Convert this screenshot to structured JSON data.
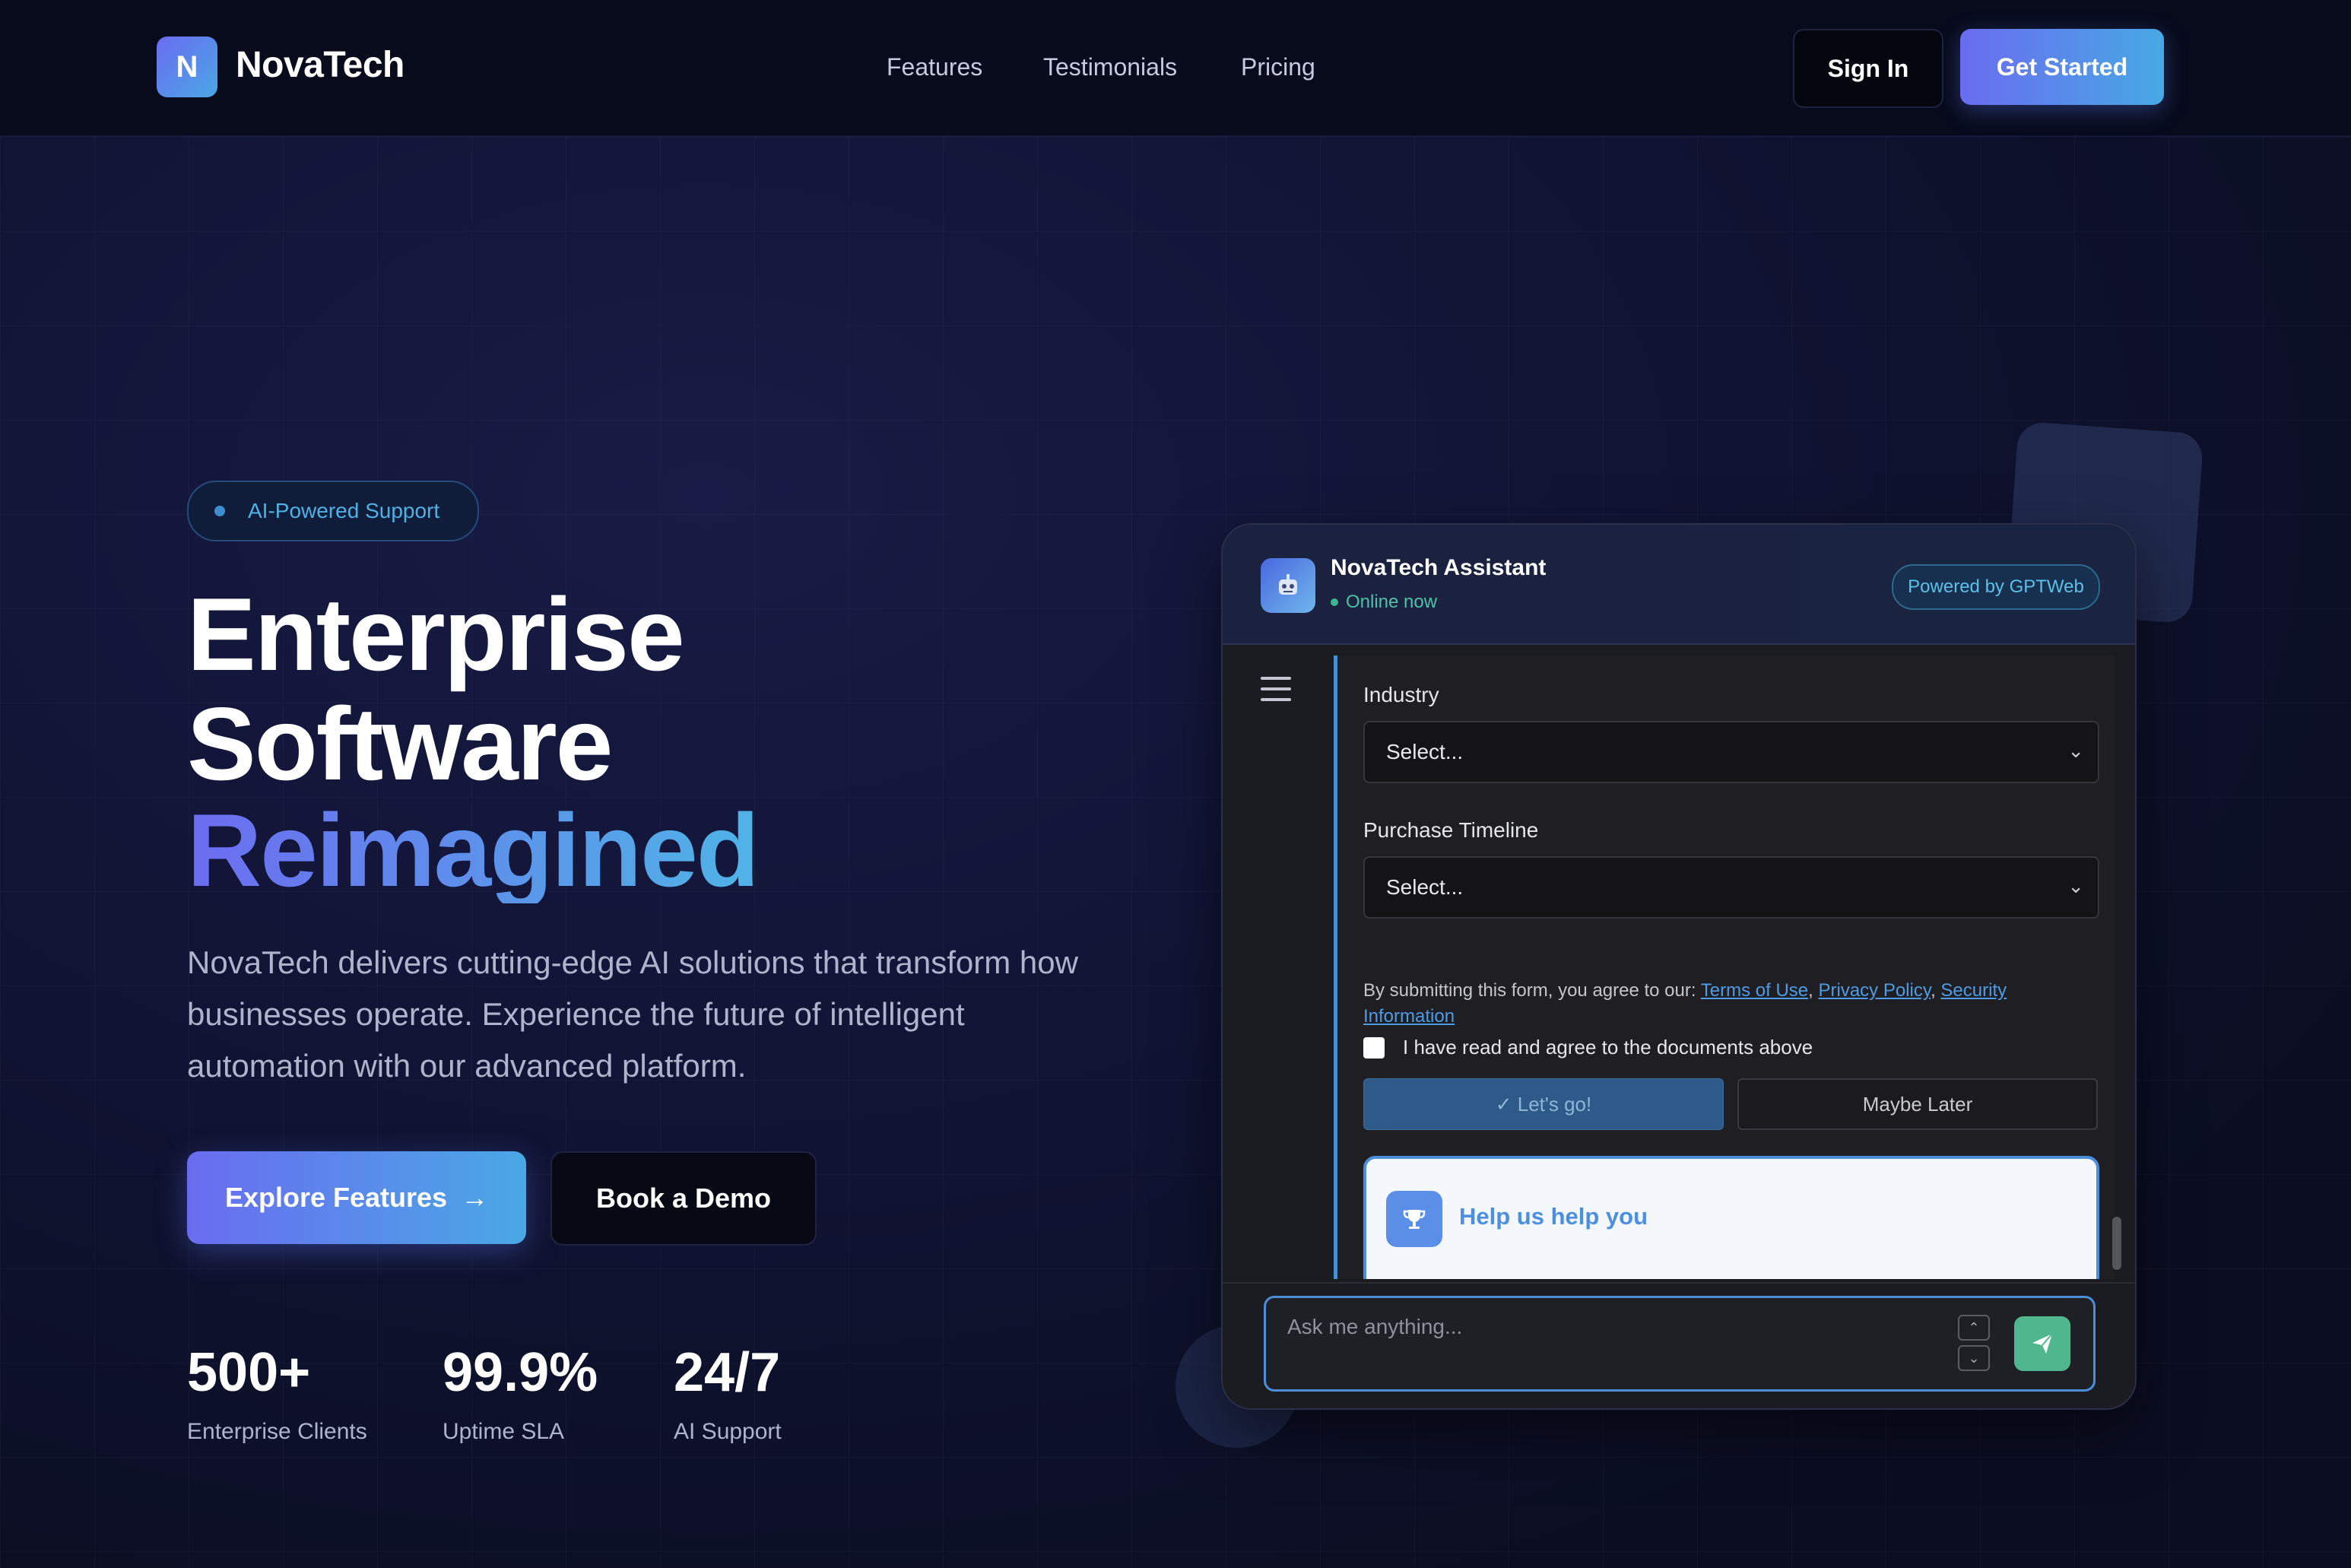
{
  "nav": {
    "logo_letter": "N",
    "brand": "NovaTech",
    "links": [
      "Features",
      "Testimonials",
      "Pricing"
    ],
    "sign_in": "Sign In",
    "get_started": "Get Started"
  },
  "hero": {
    "badge": "AI-Powered Support",
    "title_line1": "Enterprise",
    "title_line2": "Software",
    "title_line3": "Reimagined",
    "subtitle": "NovaTech delivers cutting-edge AI solutions that transform how businesses operate. Experience the future of intelligent automation with our advanced platform.",
    "cta_primary": "Explore Features",
    "cta_secondary": "Book a Demo",
    "stats": [
      {
        "value": "500+",
        "label": "Enterprise Clients"
      },
      {
        "value": "99.9%",
        "label": "Uptime SLA"
      },
      {
        "value": "24/7",
        "label": "AI Support"
      }
    ]
  },
  "chat": {
    "title": "NovaTech Assistant",
    "status": "Online now",
    "powered_by": "Powered by GPTWeb",
    "avatar_icon": "robot-icon",
    "form": {
      "industry_label": "Industry",
      "industry_value": "Select...",
      "timeline_label": "Purchase Timeline",
      "timeline_value": "Select...",
      "terms_prefix": "By submitting this form, you agree to our:",
      "terms_link": "Terms of Use",
      "privacy_link": "Privacy Policy",
      "security_link": "Security Information",
      "agree_label": "I have read and agree to the documents above",
      "submit_label": "✓ Let's go!",
      "decline_label": "Maybe Later"
    },
    "help_card_title": "Help us help you",
    "input_placeholder": "Ask me anything..."
  },
  "colors": {
    "accent_start": "#6a6cf0",
    "accent_end": "#47a9e4",
    "online": "#3fb28e",
    "send_button": "#4fb68e"
  }
}
